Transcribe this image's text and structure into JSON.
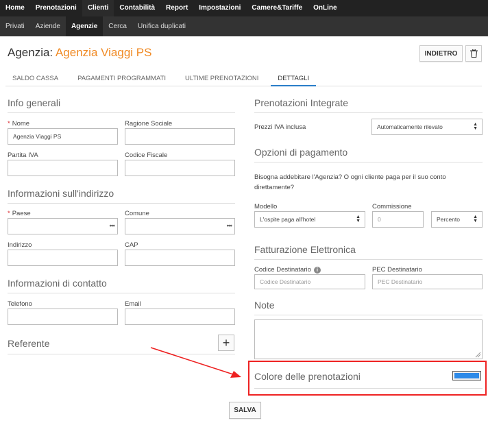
{
  "topnav": {
    "items": [
      "Home",
      "Prenotazioni",
      "Clienti",
      "Contabilità",
      "Report",
      "Impostazioni",
      "Camere&Tariffe",
      "OnLine"
    ]
  },
  "subnav": {
    "items": [
      "Privati",
      "Aziende",
      "Agenzie",
      "Cerca",
      "Unifica duplicati"
    ]
  },
  "page": {
    "title_prefix": "Agenzia:",
    "agency_name": "Agenzia Viaggi PS",
    "back_label": "INDIETRO"
  },
  "tabs": [
    "SALDO CASSA",
    "PAGAMENTI PROGRAMMATI",
    "ULTIME PRENOTAZIONI",
    "DETTAGLI"
  ],
  "info_generali": {
    "title": "Info generali",
    "nome_label": "Nome",
    "nome_value": "Agenzia Viaggi PS",
    "ragione_label": "Ragione Sociale",
    "piva_label": "Partita IVA",
    "cf_label": "Codice Fiscale"
  },
  "indirizzo": {
    "title": "Informazioni sull'indirizzo",
    "paese_label": "Paese",
    "comune_label": "Comune",
    "indirizzo_label": "Indirizzo",
    "cap_label": "CAP",
    "dots": "•••"
  },
  "contatto": {
    "title": "Informazioni di contatto",
    "telefono_label": "Telefono",
    "email_label": "Email"
  },
  "referente": {
    "title": "Referente",
    "add": "+"
  },
  "prenotazioni_integrate": {
    "title": "Prenotazioni Integrate",
    "prezzi_label": "Prezzi IVA inclusa",
    "prezzi_value": "Automaticamente rilevato"
  },
  "pagamento": {
    "title": "Opzioni di pagamento",
    "question": "Bisogna addebitare l'Agenzia? O ogni cliente paga per il suo conto direttamente?",
    "modello_label": "Modello",
    "modello_value": "L'ospite paga all'hotel",
    "commissione_label": "Commissione",
    "commissione_placeholder": "0",
    "unit_value": "Percento"
  },
  "fatturazione": {
    "title": "Fatturazione Elettronica",
    "codice_label": "Codice Destinatario",
    "codice_placeholder": "Codice Destinatario",
    "pec_label": "PEC Destinatario",
    "pec_placeholder": "PEC Destinatario",
    "info": "i"
  },
  "note": {
    "title": "Note"
  },
  "colore": {
    "title": "Colore delle prenotazioni",
    "color": "#2d8ae8"
  },
  "save_label": "SALVA",
  "colors": {
    "accent": "#f08a24",
    "nav_bg": "#222222",
    "subnav_bg": "#333333",
    "highlight": "#e22222",
    "required": "#d9262c"
  }
}
